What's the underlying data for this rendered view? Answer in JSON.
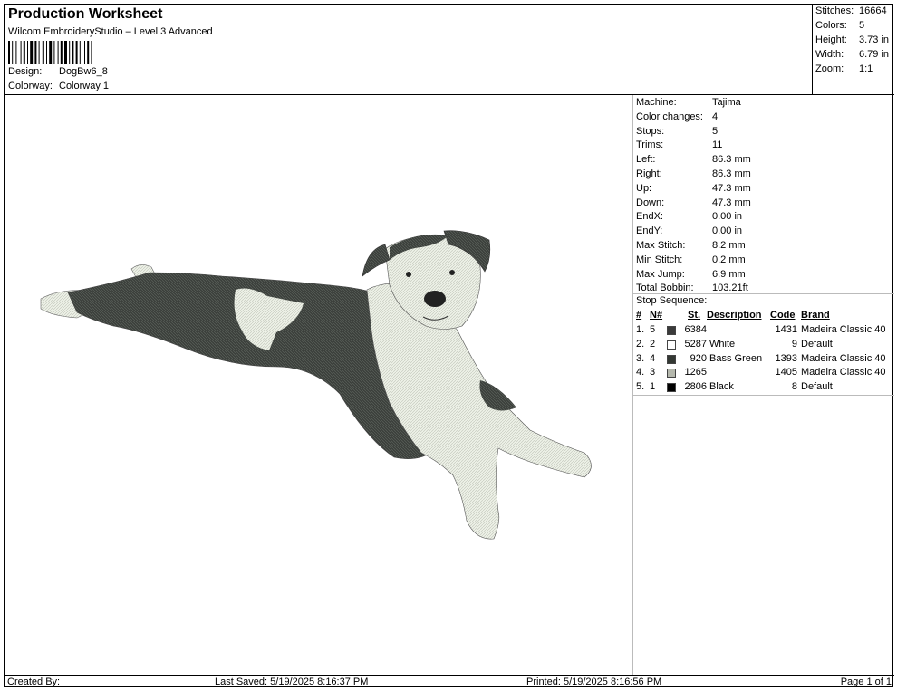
{
  "header": {
    "title": "Production Worksheet",
    "software": "Wilcom EmbroideryStudio – Level 3 Advanced",
    "design_label": "Design:",
    "design_value": "DogBw6_8",
    "colorway_label": "Colorway:",
    "colorway_value": "Colorway 1"
  },
  "stats": [
    {
      "label": "Stitches:",
      "value": "16664"
    },
    {
      "label": "Colors:",
      "value": "5"
    },
    {
      "label": "Height:",
      "value": "3.73 in"
    },
    {
      "label": "Width:",
      "value": "6.79 in"
    },
    {
      "label": "Zoom:",
      "value": "1:1"
    }
  ],
  "machine": [
    {
      "label": "Machine:",
      "value": "Tajima"
    },
    {
      "label": "Color changes:",
      "value": "4"
    },
    {
      "label": "Stops:",
      "value": "5"
    },
    {
      "label": "Trims:",
      "value": "11"
    },
    {
      "label": "Left:",
      "value": "86.3 mm"
    },
    {
      "label": "Right:",
      "value": "86.3 mm"
    },
    {
      "label": "Up:",
      "value": "47.3 mm"
    },
    {
      "label": "Down:",
      "value": "47.3 mm"
    },
    {
      "label": "EndX:",
      "value": "0.00 in"
    },
    {
      "label": "EndY:",
      "value": "0.00 in"
    },
    {
      "label": "Max Stitch:",
      "value": "8.2 mm"
    },
    {
      "label": "Min Stitch:",
      "value": "0.2 mm"
    },
    {
      "label": "Max Jump:",
      "value": "6.9 mm"
    },
    {
      "label": "Total Bobbin:",
      "value": "103.21ft"
    }
  ],
  "stop_sequence": {
    "title": "Stop Sequence:",
    "headers": {
      "num": "#",
      "n": "N#",
      "st": "St.",
      "description": "Description",
      "code": "Code",
      "brand": "Brand"
    },
    "rows": [
      {
        "num": "1.",
        "n": "5",
        "color": "#3a3a3a",
        "st": "6384",
        "description": "",
        "code": "1431",
        "brand": "Madeira Classic 40"
      },
      {
        "num": "2.",
        "n": "2",
        "color": "#ffffff",
        "st": "5287",
        "description": "White",
        "code": "9",
        "brand": "Default"
      },
      {
        "num": "3.",
        "n": "4",
        "color": "#333833",
        "st": "920",
        "description": "Bass Green",
        "code": "1393",
        "brand": "Madeira Classic 40"
      },
      {
        "num": "4.",
        "n": "3",
        "color": "#b5b8ad",
        "st": "1265",
        "description": "",
        "code": "1405",
        "brand": "Madeira Classic 40"
      },
      {
        "num": "5.",
        "n": "1",
        "color": "#000000",
        "st": "2806",
        "description": "Black",
        "code": "8",
        "brand": "Default"
      }
    ]
  },
  "footer": {
    "created_by": "Created By:",
    "last_saved": "Last Saved: 5/19/2025 8:16:37 PM",
    "printed": "Printed: 5/19/2025 8:16:56 PM",
    "page": "Page 1 of 1"
  }
}
